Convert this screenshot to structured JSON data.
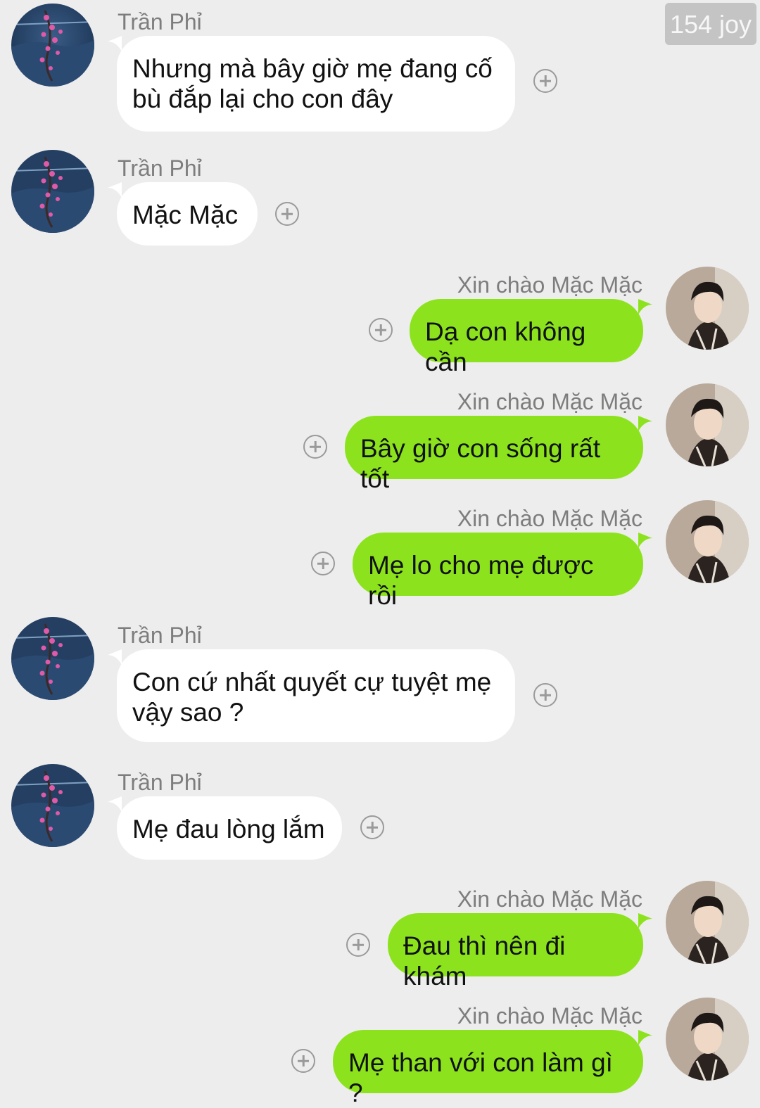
{
  "badge": "154 joy",
  "names": {
    "other": "Trần Phỉ",
    "self": "Xin chào Mặc Mặc"
  },
  "icons": {
    "other_avatar": "plum-blossom-avatar-icon",
    "self_avatar": "profile-photo-avatar-icon",
    "add": "plus-circle-icon"
  },
  "colors": {
    "background": "#ededed",
    "incoming_bubble": "#ffffff",
    "outgoing_bubble": "#8ce31d",
    "name_text": "#7d7d7d"
  },
  "messages": [
    {
      "sender": "Trần Phỉ",
      "text": "Nhưng mà bây giờ mẹ đang cố\nbù đắp lại cho con đây"
    },
    {
      "sender": "Trần Phỉ",
      "text": "Mặc Mặc"
    },
    {
      "sender": "Xin chào Mặc Mặc",
      "text": "Dạ con không cần"
    },
    {
      "sender": "Xin chào Mặc Mặc",
      "text": "Bây giờ con sống rất tốt"
    },
    {
      "sender": "Xin chào Mặc Mặc",
      "text": "Mẹ lo cho mẹ được rồi"
    },
    {
      "sender": "Trần Phỉ",
      "text": "Con cứ nhất quyết cự tuyệt mẹ\nvậy sao ?"
    },
    {
      "sender": "Trần Phỉ",
      "text": "Mẹ đau lòng lắm"
    },
    {
      "sender": "Xin chào Mặc Mặc",
      "text": "Đau thì nên đi khám"
    },
    {
      "sender": "Xin chào Mặc Mặc",
      "text": "Mẹ than với con làm gì ?"
    }
  ]
}
